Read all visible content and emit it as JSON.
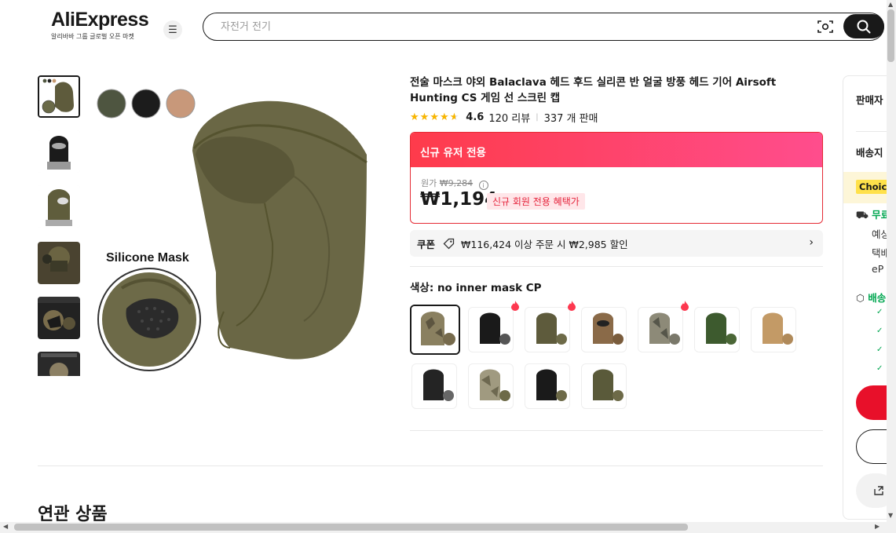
{
  "header": {
    "logo_text": "AliExpress",
    "logo_tagline": "알리바바 그룹 글로벌 오픈 마켓",
    "search_placeholder": "자전거 전기"
  },
  "product": {
    "title": "전술 마스크 야외 Balaclava 헤드 후드 실리콘 반 얼굴 방풍 헤드 기어 Airsoft Hunting CS 게임 선 스크린 캡",
    "rating": "4.6",
    "reviews": "120 리뷰",
    "sold": "337 개 판매",
    "stars": 4.6,
    "main_image_label": "Silicone Mask"
  },
  "promo": {
    "header": "신규 유저 전용",
    "original_label": "원가",
    "original_price": "₩9,284",
    "price": "₩1,194",
    "badge": "신규 회원 전용 혜택가"
  },
  "coupon": {
    "label": "쿠폰",
    "text": "₩116,424 이상 주문 시 ₩2,985 할인"
  },
  "color": {
    "label": "색상: no inner mask CP"
  },
  "related_title": "연관 상품",
  "right_panel": {
    "seller": "판매자",
    "shipping": "배송지",
    "choice": "Choice",
    "free": "무료",
    "line1": "예상",
    "line2": "택배",
    "line3": "eP",
    "delivery": "배송"
  }
}
